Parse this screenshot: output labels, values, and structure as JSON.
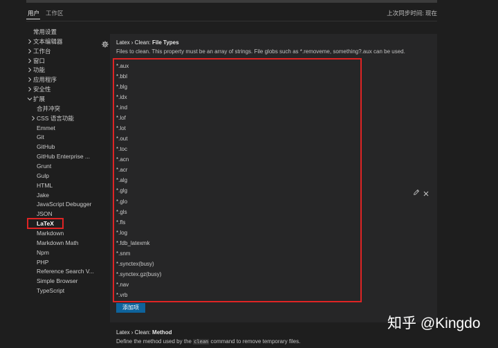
{
  "header": {
    "tab_user": "用户",
    "tab_workspace": "工作区",
    "active_tab": "用户",
    "sync_status": "上次同步时间: 现在"
  },
  "sidebar": {
    "items": [
      {
        "label": "常用设置",
        "chevron": "none"
      },
      {
        "label": "文本编辑器",
        "chevron": "right"
      },
      {
        "label": "工作台",
        "chevron": "right"
      },
      {
        "label": "窗口",
        "chevron": "right"
      },
      {
        "label": "功能",
        "chevron": "right"
      },
      {
        "label": "应用程序",
        "chevron": "right"
      },
      {
        "label": "安全性",
        "chevron": "right"
      },
      {
        "label": "扩展",
        "chevron": "down"
      },
      {
        "label": "合并冲突",
        "chevron": "none"
      },
      {
        "label": "CSS 语言功能",
        "chevron": "right"
      },
      {
        "label": "Emmet",
        "chevron": "none"
      },
      {
        "label": "Git",
        "chevron": "none"
      },
      {
        "label": "GitHub",
        "chevron": "none"
      },
      {
        "label": "GitHub Enterprise ...",
        "chevron": "none"
      },
      {
        "label": "Grunt",
        "chevron": "none"
      },
      {
        "label": "Gulp",
        "chevron": "none"
      },
      {
        "label": "HTML",
        "chevron": "none"
      },
      {
        "label": "Jake",
        "chevron": "none"
      },
      {
        "label": "JavaScript Debugger",
        "chevron": "none"
      },
      {
        "label": "JSON",
        "chevron": "none"
      },
      {
        "label": "LaTeX",
        "chevron": "none",
        "selected": true
      },
      {
        "label": "Markdown",
        "chevron": "none"
      },
      {
        "label": "Markdown Math",
        "chevron": "none"
      },
      {
        "label": "Npm",
        "chevron": "none"
      },
      {
        "label": "PHP",
        "chevron": "none"
      },
      {
        "label": "Reference Search V...",
        "chevron": "none"
      },
      {
        "label": "Simple Browser",
        "chevron": "none"
      },
      {
        "label": "TypeScript",
        "chevron": "none"
      }
    ]
  },
  "setting_file_types": {
    "category": "Latex › Clean: ",
    "name": "File Types",
    "description": "Files to clean. This property must be an array of strings. File globs such as *.removeme, something?.aux can be used.",
    "items": [
      "*.aux",
      "*.bbl",
      "*.blg",
      "*.idx",
      "*.ind",
      "*.lof",
      "*.lot",
      "*.out",
      "*.toc",
      "*.acn",
      "*.acr",
      "*.alg",
      "*.glg",
      "*.glo",
      "*.gls",
      "*.fls",
      "*.log",
      "*.fdb_latexmk",
      "*.snm",
      "*.synctex(busy)",
      "*.synctex.gz(busy)",
      "*.nav",
      "*.vrb"
    ],
    "add_button": "添加项"
  },
  "setting_method": {
    "category": "Latex › Clean: ",
    "name": "Method",
    "description_before": "Define the method used by the ",
    "description_code": "clean",
    "description_after": " command to remove temporary files."
  },
  "watermark": "知乎 @Kingdo",
  "icons": {
    "settings": "gear-icon",
    "edit_item": "pencil-icon",
    "remove_item": "close-icon",
    "collapsed": "chevron-right-icon",
    "expanded": "chevron-down-icon"
  },
  "colors": {
    "background": "#1e1e1e",
    "panel": "#262627",
    "button": "#0e639c",
    "highlight_outline": "#e02424",
    "text": "#cccccc"
  }
}
